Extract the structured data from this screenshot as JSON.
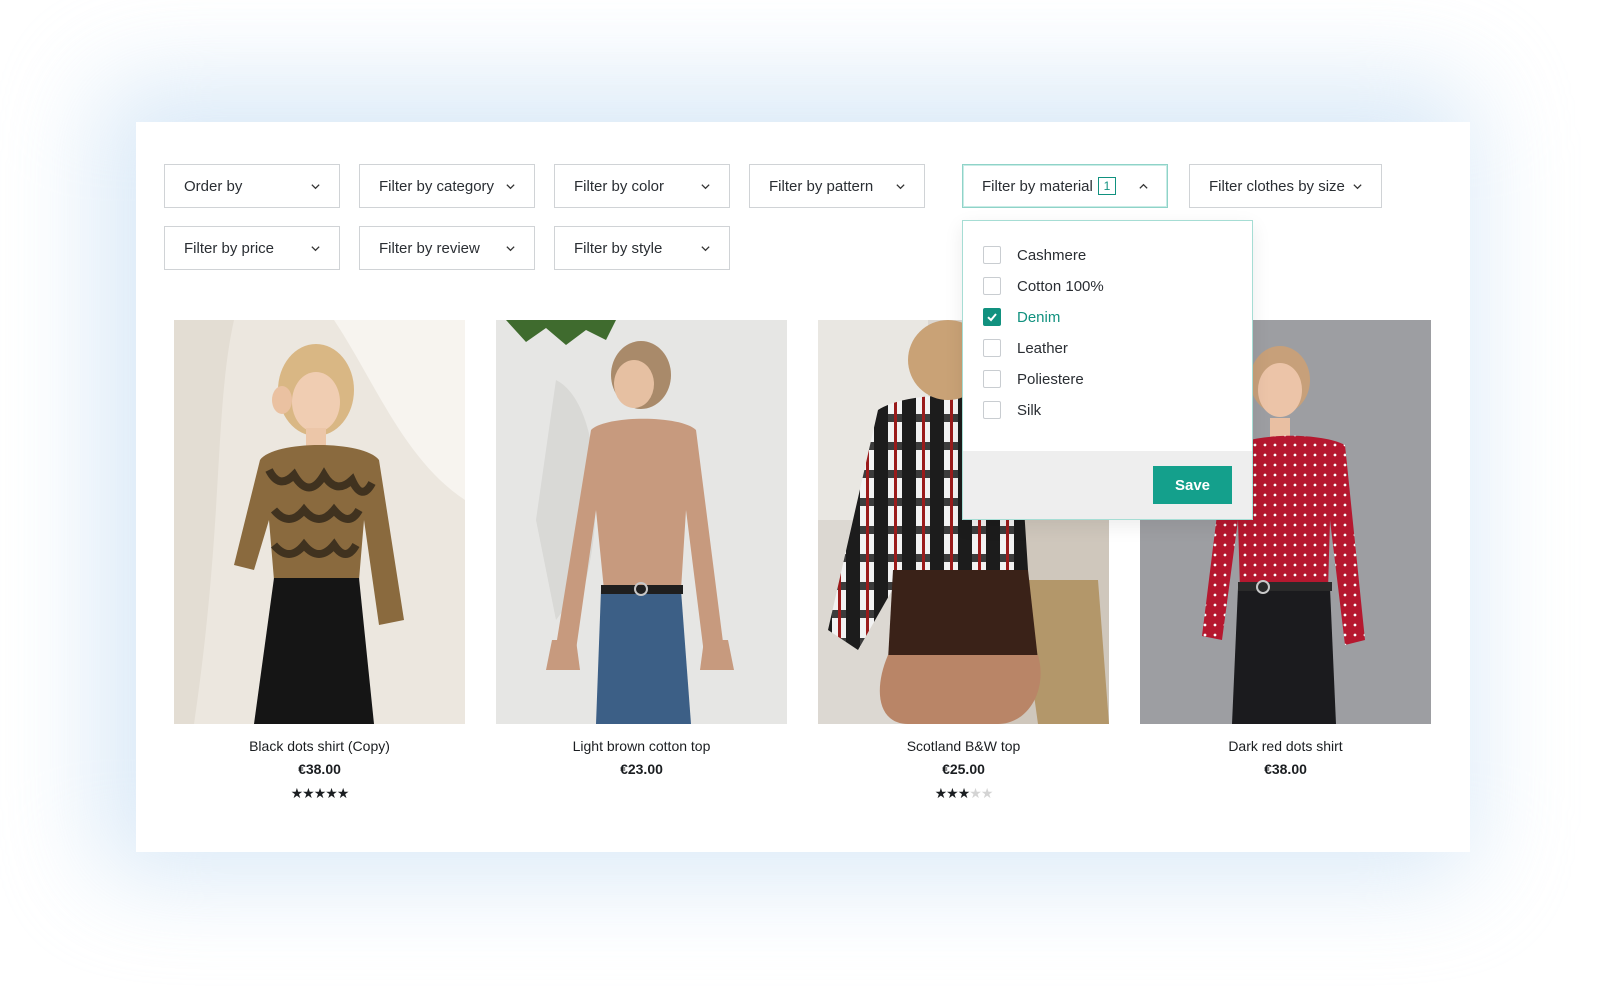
{
  "filters": {
    "order_by": "Order by",
    "category": "Filter by category",
    "color": "Filter by color",
    "pattern": "Filter by pattern",
    "material": "Filter by material",
    "material_count": "1",
    "size": "Filter clothes by size",
    "price": "Filter by price",
    "review": "Filter by review",
    "style": "Filter by style"
  },
  "material_dropdown": {
    "options": [
      {
        "label": "Cashmere",
        "checked": false
      },
      {
        "label": "Cotton 100%",
        "checked": false
      },
      {
        "label": "Denim",
        "checked": true
      },
      {
        "label": "Leather",
        "checked": false
      },
      {
        "label": "Poliestere",
        "checked": false
      },
      {
        "label": "Silk",
        "checked": false
      }
    ],
    "save_label": "Save"
  },
  "products": [
    {
      "name": "Black dots shirt (Copy)",
      "price": "€38.00",
      "stars": "★★★★★",
      "rating": 5
    },
    {
      "name": "Light brown cotton top",
      "price": "€23.00",
      "stars": "",
      "rating": null
    },
    {
      "name": "Scotland B&W top",
      "price": "€25.00",
      "stars_on": "★★★",
      "stars_off": "★★",
      "rating": 3
    },
    {
      "name": "Dark red dots shirt",
      "price": "€38.00",
      "stars": "",
      "rating": null
    }
  ],
  "colors": {
    "accent": "#14a08c",
    "accent_dark": "#11917f",
    "border": "#d0d3d6"
  },
  "icons": {
    "dropdown": "chevron-down-icon",
    "dropdown_open": "chevron-up-icon",
    "checkbox_checked": "checkmark-icon",
    "star": "star-icon"
  }
}
